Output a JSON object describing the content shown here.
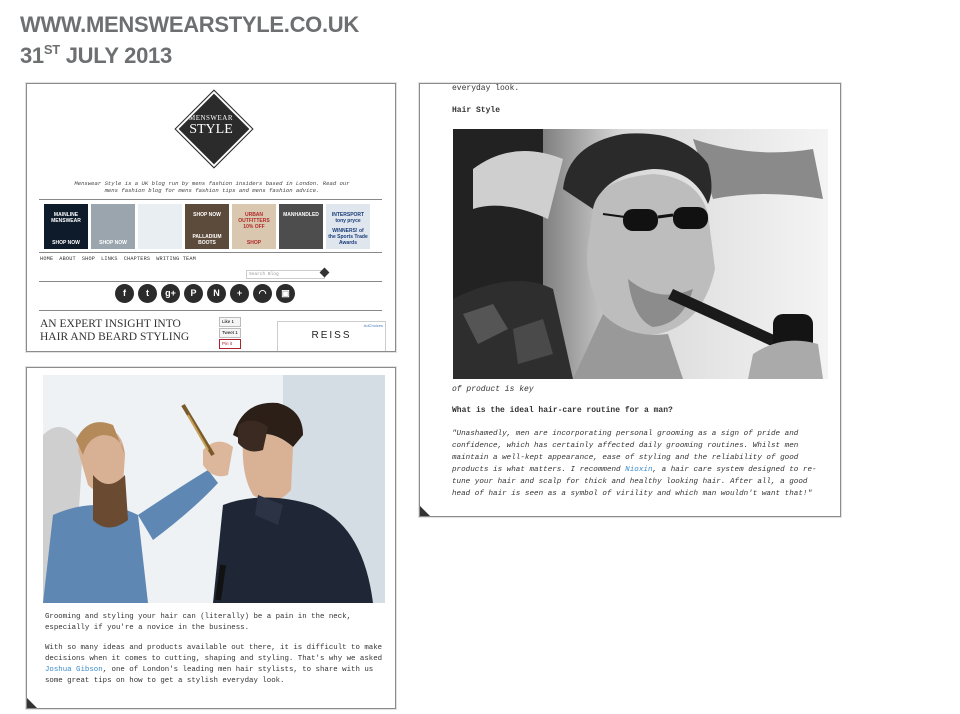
{
  "header": {
    "site": "WWW.MENSWEARSTYLE.CO.UK",
    "day": "31",
    "day_suffix": "ST",
    "month_year": "JULY 2013"
  },
  "site_screenshot": {
    "logo_top": "MENSWEAR",
    "logo_bottom": "STYLE",
    "tagline": "Menswear Style is a UK blog run by mens fashion insiders based in London. Read our mens fashion blog for mens fashion tips and mens fashion advice.",
    "thumbnails": [
      {
        "label": "MAINLINE MENSWEAR",
        "sub": "SHOP NOW",
        "color": "#0d1b2a",
        "fg": "#ffffff"
      },
      {
        "label": "",
        "sub": "SHOP NOW",
        "color": "#9aa5ad",
        "fg": "#ffffff"
      },
      {
        "label": "",
        "sub": "",
        "color": "#e9eef3",
        "fg": "#333333"
      },
      {
        "label": "SHOP NOW",
        "sub": "PALLADIUM BOOTS",
        "color": "#5c4a3a",
        "fg": "#ffffff"
      },
      {
        "label": "URBAN OUTFITTERS 10% OFF",
        "sub": "SHOP",
        "color": "#d9c7b0",
        "fg": "#b12a2a"
      },
      {
        "label": "MANHANDLED",
        "sub": "",
        "color": "#4d4d4d",
        "fg": "#ffffff"
      },
      {
        "label": "INTERSPORT tony pryce",
        "sub": "WINNERS! of the Sports Trade Awards",
        "color": "#dfe6ee",
        "fg": "#1b3c7a"
      }
    ],
    "nav": [
      "HOME",
      "ABOUT",
      "SHOP",
      "LINKS",
      "CHAPTERS",
      "WRITING TEAM"
    ],
    "search_placeholder": "Search Blog",
    "social_icons": [
      {
        "name": "facebook-icon",
        "glyph": "f"
      },
      {
        "name": "twitter-icon",
        "glyph": "t"
      },
      {
        "name": "google-plus-icon",
        "glyph": "g+"
      },
      {
        "name": "pinterest-icon",
        "glyph": "P"
      },
      {
        "name": "n-icon",
        "glyph": "N"
      },
      {
        "name": "plus-icon",
        "glyph": "+"
      },
      {
        "name": "rss-icon",
        "glyph": "◠"
      },
      {
        "name": "instagram-icon",
        "glyph": "▣"
      }
    ],
    "article_title_1": "AN EXPERT INSIGHT INTO",
    "article_title_2": "HAIR AND BEARD STYLING",
    "share_like": "Like 1",
    "share_tweet": "Tweet 1",
    "share_pin": "Pin it",
    "ad_brand": "REISS",
    "ad_choices": "AdChoices"
  },
  "article_right": {
    "top_text": "everyday look.",
    "subhead": "Hair Style",
    "caption": "of product is key",
    "question": "What is the ideal hair-care routine for a man?",
    "quote_before_link": "\"Unashamedly, men are incorporating personal grooming as a sign of pride and confidence, which has certainly affected daily grooming routines. Whilst men maintain a well-kept appearance, ease of styling and the reliability of good products is what matters. I recommend ",
    "quote_link": "Nioxin",
    "quote_after_link": ", a hair care system designed to re-tune your hair and scalp for thick and healthy looking hair. After all, a good head of hair is seen as a symbol of virility and which man wouldn't want that!\""
  },
  "article_left": {
    "para1": "Grooming and styling your hair can (literally) be a pain in the neck, especially if you're a novice in the business.",
    "para2_before": "With so many ideas and products available out there, it is difficult to make decisions when it comes to cutting, shaping and styling. That's why we asked ",
    "para2_link": "Joshua Gibson",
    "para2_after": ", one of London's leading men hair stylists, to share with us some great tips on how to get a stylish everyday look."
  }
}
